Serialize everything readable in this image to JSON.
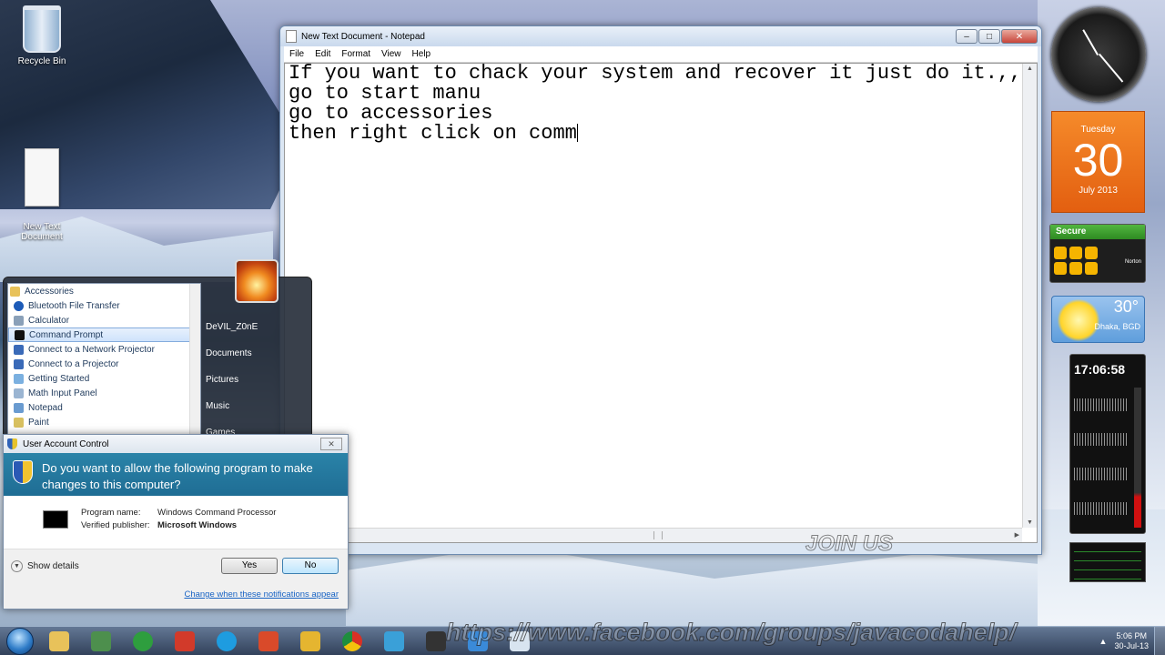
{
  "desktop": {
    "recycle_bin": "Recycle Bin",
    "text_doc": "New Text\nDocument"
  },
  "notepad": {
    "title": "New Text Document - Notepad",
    "menu": [
      "File",
      "Edit",
      "Format",
      "View",
      "Help"
    ],
    "lines": [
      "If you want to chack your system and recover it just do it.,,",
      "go to start manu",
      "go to accessories",
      "then right click on comm"
    ]
  },
  "start_menu": {
    "programs": [
      {
        "label": "Accessories",
        "icon": "folder-icon",
        "selected": false
      },
      {
        "label": "Bluetooth File Transfer",
        "icon": "bluetooth-icon",
        "selected": false
      },
      {
        "label": "Calculator",
        "icon": "calculator-icon",
        "selected": false
      },
      {
        "label": "Command Prompt",
        "icon": "cmd-icon",
        "selected": true
      },
      {
        "label": "Connect to a Network Projector",
        "icon": "projector-icon",
        "selected": false
      },
      {
        "label": "Connect to a Projector",
        "icon": "projector-icon",
        "selected": false
      },
      {
        "label": "Getting Started",
        "icon": "getting-started-icon",
        "selected": false
      },
      {
        "label": "Math Input Panel",
        "icon": "math-icon",
        "selected": false
      },
      {
        "label": "Notepad",
        "icon": "notepad-icon",
        "selected": false
      },
      {
        "label": "Paint",
        "icon": "paint-icon",
        "selected": false
      }
    ],
    "right_items": [
      "DeVIL_Z0nE",
      "Documents",
      "Pictures",
      "Music",
      "Games"
    ]
  },
  "uac": {
    "title": "User Account Control",
    "question": "Do you want to allow the following program to make changes to this computer?",
    "program_label": "Program name:",
    "program_value": "Windows Command Processor",
    "publisher_label": "Verified publisher:",
    "publisher_value": "Microsoft Windows",
    "show_details": "Show details",
    "yes": "Yes",
    "no": "No",
    "link": "Change when these notifications appear"
  },
  "gadgets": {
    "calendar_day": "Tuesday",
    "calendar_date": "30",
    "calendar_month": "July 2013",
    "norton_status": "Secure",
    "norton_brand": "Norton",
    "weather_temp": "30°",
    "weather_location": "Dhaka, BGD",
    "cpu_time": "17:06:58"
  },
  "watermarks": {
    "join": "JOIN US",
    "facebook": "https://www.facebook.com/groups/javacodahelp/"
  },
  "taskbar": {
    "clock_time": "5:06 PM",
    "clock_date": "30-Jul-13",
    "apps": [
      {
        "name": "explorer-icon",
        "color": "#e8c25a"
      },
      {
        "name": "computer-icon",
        "color": "#4d8f4d"
      },
      {
        "name": "utorrent-icon",
        "color": "#2e9e3e"
      },
      {
        "name": "flash-icon",
        "color": "#d23a2a"
      },
      {
        "name": "skype-icon",
        "color": "#1e9ce0"
      },
      {
        "name": "solitaire-icon",
        "color": "#d94a2a"
      },
      {
        "name": "tool-icon",
        "color": "#e5b530"
      },
      {
        "name": "chrome-icon",
        "color": "#e5b530"
      },
      {
        "name": "control-panel-icon",
        "color": "#3aa0d8"
      },
      {
        "name": "cmd-icon",
        "color": "#333333"
      },
      {
        "name": "paint-icon",
        "color": "#3a8ad8"
      },
      {
        "name": "notepad-icon",
        "color": "#d8e4f0"
      }
    ]
  }
}
